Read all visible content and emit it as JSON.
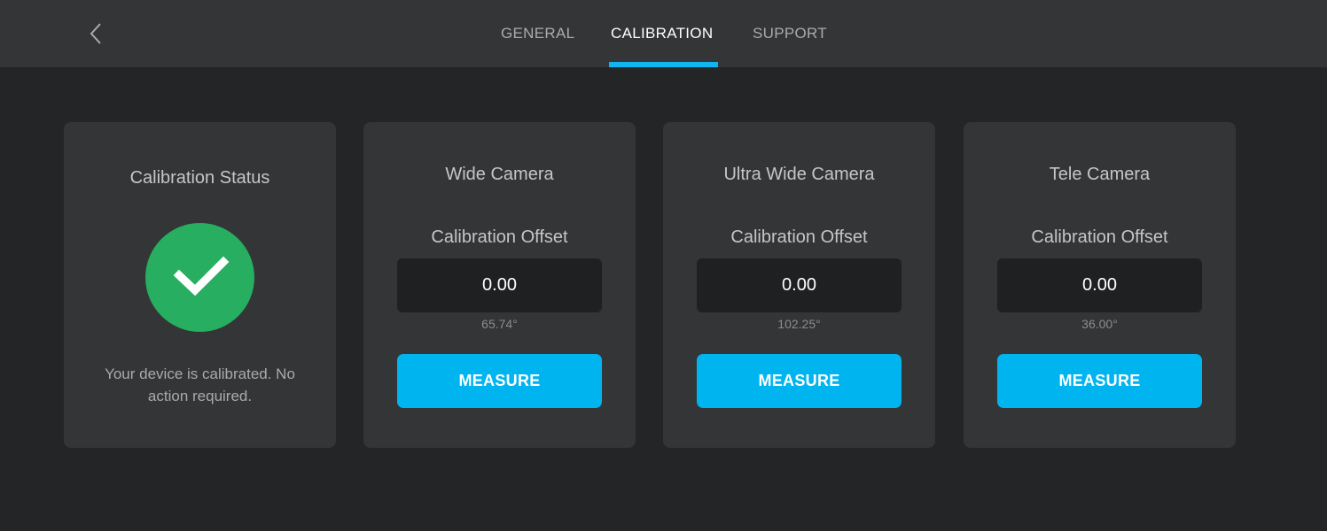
{
  "header": {
    "back_icon": "chevron-left-icon",
    "tabs": [
      {
        "label": "GENERAL",
        "active": false
      },
      {
        "label": "CALIBRATION",
        "active": true
      },
      {
        "label": "SUPPORT",
        "active": false
      }
    ]
  },
  "status_card": {
    "title": "Calibration Status",
    "icon": "checkmark-icon",
    "state": "calibrated",
    "message": "Your device is calibrated. No action required."
  },
  "cameras": [
    {
      "title": "Wide Camera",
      "offset_label": "Calibration Offset",
      "offset_value": "0.00",
      "fov": "65.74°",
      "button_label": "MEASURE"
    },
    {
      "title": "Ultra Wide Camera",
      "offset_label": "Calibration Offset",
      "offset_value": "0.00",
      "fov": "102.25°",
      "button_label": "MEASURE"
    },
    {
      "title": "Tele Camera",
      "offset_label": "Calibration Offset",
      "offset_value": "0.00",
      "fov": "36.00°",
      "button_label": "MEASURE"
    }
  ],
  "colors": {
    "accent": "#00b4f0",
    "success": "#27ae60",
    "background": "#242527",
    "card": "#333537"
  }
}
